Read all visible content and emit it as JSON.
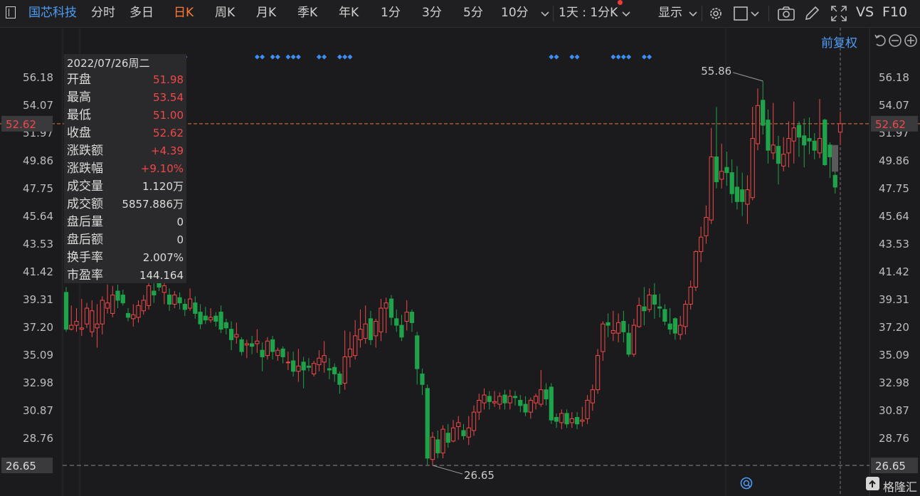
{
  "toolbar": {
    "stock_name": "国芯科技",
    "tabs": [
      "分时",
      "多日",
      "日K",
      "周K",
      "月K",
      "季K",
      "年K",
      "1分",
      "3分",
      "5分",
      "10分"
    ],
    "active_tab": "日K",
    "period_select": "1天 : 1分K",
    "display_label": "显示",
    "vs_label": "VS",
    "f10_label": "F10"
  },
  "adjust_label": "前复权",
  "info_panel": {
    "date": "2022/07/26周二",
    "rows": [
      {
        "label": "开盘",
        "value": "51.98",
        "color": "red"
      },
      {
        "label": "最高",
        "value": "53.54",
        "color": "red"
      },
      {
        "label": "最低",
        "value": "51.00",
        "color": "red"
      },
      {
        "label": "收盘",
        "value": "52.62",
        "color": "red"
      },
      {
        "label": "涨跌额",
        "value": "+4.39",
        "color": "red"
      },
      {
        "label": "涨跌幅",
        "value": "+9.10%",
        "color": "red"
      },
      {
        "label": "成交量",
        "value": "1.120万",
        "color": "white"
      },
      {
        "label": "成交额",
        "value": "5857.886万",
        "color": "white"
      },
      {
        "label": "盘后量",
        "value": "0",
        "color": "white"
      },
      {
        "label": "盘后额",
        "value": "0",
        "color": "white"
      },
      {
        "label": "换手率",
        "value": "2.007%",
        "color": "white"
      },
      {
        "label": "市盈率",
        "value": "144.164",
        "color": "white"
      }
    ]
  },
  "watermark": "格隆汇",
  "chart_data": {
    "type": "candlestick",
    "ylim": [
      25.2,
      58.0
    ],
    "yticks": [
      "56.18",
      "54.07",
      "51.97",
      "49.86",
      "47.75",
      "45.64",
      "43.53",
      "41.42",
      "39.31",
      "37.20",
      "35.09",
      "32.98",
      "30.87",
      "28.76",
      "26.65"
    ],
    "current_price": "52.62",
    "max_label": "55.86",
    "min_label": "26.65",
    "colors": {
      "up": "#f04848",
      "down": "#1fa34a",
      "marker": "#3d8ef0",
      "current_line": "#e8783a",
      "min_line": "#8a8a8a"
    },
    "marker_days": [
      0,
      1,
      2,
      3,
      8,
      9,
      10,
      11,
      12,
      17,
      18,
      22,
      23,
      37,
      38,
      40,
      41,
      43,
      44,
      45,
      49,
      50,
      53,
      54,
      55,
      94,
      95,
      98,
      99,
      106,
      107,
      108,
      109,
      112,
      113
    ],
    "candles": [
      [
        39.8,
        37.0,
        40.2,
        36.8
      ],
      [
        37.0,
        37.3,
        38.8,
        36.9
      ],
      [
        37.3,
        37.6,
        38.6,
        36.8
      ],
      [
        37.0,
        37.1,
        39.3,
        36.5
      ],
      [
        37.4,
        38.6,
        39.0,
        37.1
      ],
      [
        36.8,
        38.4,
        39.2,
        36.4
      ],
      [
        37.1,
        37.4,
        38.9,
        35.6
      ],
      [
        37.4,
        39.2,
        39.5,
        36.6
      ],
      [
        38.6,
        39.0,
        40.4,
        38.2
      ],
      [
        38.2,
        39.6,
        40.3,
        37.9
      ],
      [
        39.9,
        39.2,
        40.4,
        38.6
      ],
      [
        39.6,
        39.0,
        40.0,
        38.8
      ],
      [
        38.2,
        37.9,
        38.6,
        37.6
      ],
      [
        37.8,
        38.1,
        38.9,
        37.2
      ],
      [
        37.9,
        38.8,
        39.2,
        37.5
      ],
      [
        38.4,
        39.2,
        39.6,
        38.1
      ],
      [
        38.8,
        40.3,
        40.8,
        38.5
      ],
      [
        39.9,
        39.6,
        41.5,
        39.0
      ],
      [
        40.5,
        40.2,
        42.0,
        39.9
      ],
      [
        39.8,
        40.3,
        40.6,
        38.9
      ],
      [
        39.6,
        38.9,
        40.1,
        38.4
      ],
      [
        38.9,
        39.6,
        39.9,
        38.6
      ],
      [
        39.4,
        39.0,
        39.8,
        38.5
      ],
      [
        38.9,
        38.5,
        39.3,
        38.0
      ],
      [
        38.6,
        39.3,
        40.1,
        38.4
      ],
      [
        39.0,
        38.2,
        39.5,
        37.8
      ],
      [
        38.3,
        37.4,
        38.9,
        37.0
      ],
      [
        38.0,
        37.7,
        38.7,
        37.4
      ],
      [
        37.7,
        37.9,
        38.6,
        37.5
      ],
      [
        38.0,
        37.6,
        38.3,
        37.2
      ],
      [
        38.3,
        37.0,
        38.8,
        36.7
      ],
      [
        37.5,
        37.1,
        37.8,
        36.6
      ],
      [
        37.0,
        36.2,
        37.6,
        35.4
      ],
      [
        36.4,
        36.6,
        37.5,
        35.9
      ],
      [
        36.2,
        35.3,
        36.4,
        35.0
      ],
      [
        35.8,
        35.9,
        36.2,
        34.8
      ],
      [
        35.9,
        35.7,
        36.5,
        35.1
      ],
      [
        35.9,
        36.1,
        37.0,
        35.2
      ],
      [
        35.4,
        34.9,
        36.0,
        33.8
      ],
      [
        35.0,
        36.1,
        36.4,
        34.7
      ],
      [
        36.2,
        35.3,
        36.5,
        34.7
      ],
      [
        35.0,
        35.4,
        35.6,
        34.6
      ],
      [
        35.5,
        34.9,
        35.7,
        34.4
      ],
      [
        34.5,
        34.5,
        35.3,
        33.9
      ],
      [
        34.6,
        33.8,
        35.3,
        33.4
      ],
      [
        33.8,
        34.2,
        35.5,
        33.0
      ],
      [
        34.5,
        33.9,
        34.9,
        32.5
      ],
      [
        34.2,
        34.1,
        34.8,
        33.8
      ],
      [
        33.6,
        34.4,
        34.6,
        33.4
      ],
      [
        34.3,
        34.8,
        35.4,
        33.8
      ],
      [
        34.5,
        35.0,
        36.1,
        33.7
      ],
      [
        34.0,
        33.9,
        34.8,
        33.2
      ],
      [
        34.1,
        33.6,
        34.4,
        33.0
      ],
      [
        33.6,
        32.8,
        33.8,
        32.1
      ],
      [
        32.9,
        34.9,
        36.9,
        32.4
      ],
      [
        34.9,
        35.5,
        36.8,
        34.1
      ],
      [
        35.0,
        36.5,
        37.7,
        34.7
      ],
      [
        36.2,
        37.0,
        38.5,
        35.6
      ],
      [
        36.3,
        37.4,
        38.8,
        35.9
      ],
      [
        37.8,
        36.2,
        38.4,
        35.8
      ],
      [
        36.5,
        37.6,
        37.8,
        35.6
      ],
      [
        36.8,
        38.6,
        39.3,
        36.1
      ],
      [
        38.6,
        39.0,
        39.4,
        36.7
      ],
      [
        39.3,
        37.9,
        39.6,
        37.3
      ],
      [
        37.8,
        37.3,
        38.5,
        36.8
      ],
      [
        37.3,
        36.4,
        38.1,
        36.1
      ],
      [
        37.6,
        38.3,
        39.2,
        36.9
      ],
      [
        38.3,
        37.5,
        38.5,
        36.8
      ],
      [
        36.5,
        34.0,
        36.8,
        32.8
      ],
      [
        33.6,
        32.8,
        34.0,
        32.0
      ],
      [
        32.5,
        27.2,
        32.8,
        26.7
      ],
      [
        27.1,
        28.8,
        29.2,
        26.65
      ],
      [
        28.6,
        27.6,
        29.3,
        27.2
      ],
      [
        27.6,
        29.4,
        29.7,
        27.2
      ],
      [
        29.1,
        28.4,
        29.8,
        28.0
      ],
      [
        28.5,
        29.5,
        30.1,
        28.4
      ],
      [
        29.6,
        29.9,
        30.4,
        28.6
      ],
      [
        29.3,
        28.9,
        29.8,
        28.6
      ],
      [
        28.8,
        29.5,
        30.4,
        28.2
      ],
      [
        29.3,
        30.7,
        31.2,
        28.9
      ],
      [
        30.7,
        31.6,
        32.1,
        30.1
      ],
      [
        31.4,
        32.0,
        32.5,
        30.9
      ],
      [
        31.9,
        31.5,
        32.3,
        30.9
      ],
      [
        31.4,
        31.5,
        32.3,
        31.1
      ],
      [
        31.3,
        31.9,
        32.2,
        30.9
      ],
      [
        32.0,
        31.4,
        32.4,
        30.9
      ],
      [
        31.4,
        31.9,
        32.4,
        30.9
      ],
      [
        31.9,
        31.8,
        32.3,
        31.2
      ],
      [
        31.6,
        31.2,
        32.0,
        30.7
      ],
      [
        31.3,
        30.7,
        31.9,
        30.4
      ],
      [
        30.7,
        31.6,
        31.8,
        30.2
      ],
      [
        31.4,
        31.9,
        32.1,
        30.9
      ],
      [
        31.3,
        32.4,
        33.9,
        31.1
      ],
      [
        32.4,
        31.7,
        32.9,
        31.2
      ],
      [
        32.6,
        30.1,
        32.9,
        29.8
      ],
      [
        30.3,
        30.0,
        30.6,
        29.5
      ],
      [
        29.9,
        30.6,
        30.9,
        29.4
      ],
      [
        30.6,
        29.8,
        30.9,
        29.5
      ],
      [
        29.9,
        30.2,
        30.7,
        29.5
      ],
      [
        30.3,
        29.8,
        30.7,
        29.4
      ],
      [
        30.0,
        30.1,
        31.1,
        29.6
      ],
      [
        30.2,
        31.6,
        32.0,
        29.8
      ],
      [
        31.4,
        32.4,
        32.8,
        30.8
      ],
      [
        32.4,
        35.0,
        35.5,
        32.1
      ],
      [
        35.3,
        37.4,
        37.6,
        34.6
      ],
      [
        37.5,
        37.3,
        38.2,
        36.4
      ],
      [
        36.7,
        36.9,
        38.4,
        36.1
      ],
      [
        36.7,
        37.5,
        38.2,
        36.0
      ],
      [
        37.6,
        36.8,
        38.4,
        36.0
      ],
      [
        36.7,
        35.1,
        37.4,
        34.9
      ],
      [
        35.1,
        37.3,
        37.8,
        34.9
      ],
      [
        37.2,
        38.8,
        39.4,
        37.1
      ],
      [
        38.7,
        38.4,
        40.2,
        37.3
      ],
      [
        38.5,
        39.6,
        40.1,
        38.3
      ],
      [
        39.6,
        38.9,
        40.5,
        37.8
      ],
      [
        38.7,
        38.6,
        39.7,
        37.9
      ],
      [
        38.5,
        37.6,
        38.9,
        37.3
      ],
      [
        37.4,
        37.0,
        38.6,
        36.6
      ],
      [
        37.8,
        36.7,
        37.9,
        36.2
      ],
      [
        36.6,
        37.3,
        38.0,
        36.2
      ],
      [
        37.2,
        38.9,
        39.2,
        36.6
      ],
      [
        38.9,
        40.2,
        40.7,
        38.5
      ],
      [
        40.2,
        42.9,
        43.0,
        39.9
      ],
      [
        42.9,
        44.0,
        44.8,
        42.1
      ],
      [
        44.1,
        45.5,
        46.4,
        43.5
      ],
      [
        45.3,
        50.1,
        52.3,
        45.0
      ],
      [
        50.1,
        48.2,
        53.9,
        47.7
      ],
      [
        48.4,
        49.0,
        51.1,
        47.7
      ],
      [
        49.3,
        48.9,
        50.5,
        47.9
      ],
      [
        48.9,
        47.3,
        49.9,
        46.6
      ],
      [
        47.8,
        46.7,
        49.4,
        46.1
      ],
      [
        47.6,
        46.7,
        48.9,
        45.6
      ],
      [
        46.5,
        47.6,
        48.7,
        45.0
      ],
      [
        47.0,
        51.5,
        53.9,
        46.8
      ],
      [
        51.1,
        54.0,
        55.3,
        50.6
      ],
      [
        54.4,
        52.5,
        55.86,
        51.8
      ],
      [
        52.9,
        50.6,
        53.7,
        49.6
      ],
      [
        50.4,
        51.0,
        54.2,
        49.9
      ],
      [
        50.9,
        49.6,
        51.7,
        48.0
      ],
      [
        49.4,
        50.3,
        51.6,
        49.0
      ],
      [
        50.4,
        51.5,
        52.8,
        49.3
      ],
      [
        51.3,
        52.3,
        54.3,
        49.6
      ],
      [
        52.5,
        51.6,
        52.8,
        50.1
      ],
      [
        51.7,
        51.0,
        53.0,
        49.3
      ],
      [
        51.5,
        51.3,
        53.1,
        50.3
      ],
      [
        51.3,
        50.6,
        51.9,
        49.9
      ],
      [
        50.4,
        51.5,
        54.5,
        50.0
      ],
      [
        52.9,
        49.5,
        53.0,
        49.4
      ],
      [
        51.0,
        50.1,
        51.2,
        48.5
      ],
      [
        48.7,
        47.8,
        49.6,
        47.3
      ],
      [
        51.98,
        52.62,
        53.54,
        51.0
      ]
    ]
  }
}
